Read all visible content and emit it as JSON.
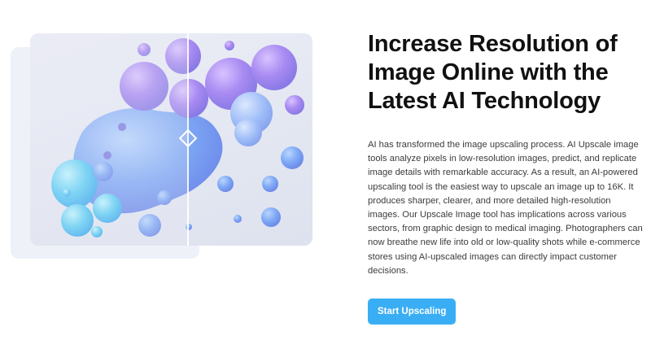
{
  "hero": {
    "title": "Increase Resolution of Image Online with the Latest AI Technology",
    "description": "AI has transformed the image upscaling process. AI Upscale image tools analyze pixels in low-resolution images, predict, and replicate image details with remarkable accuracy. As a result, an AI-powered upscaling tool is the easiest way to upscale an image up to 16K. It produces sharper, clearer, and more detailed high-resolution images. Our Upscale Image tool has implications across various sectors, from graphic design to medical imaging. Photographers can now breathe new life into old or low-quality shots while e-commerce stores using AI-upscaled images can directly impact customer decisions.",
    "cta_label": "Start Upscaling"
  },
  "colors": {
    "accent": "#3aaef4",
    "backdrop": "#eef1f8"
  },
  "icons": {
    "compare_handle": "diamond-handle-icon"
  }
}
